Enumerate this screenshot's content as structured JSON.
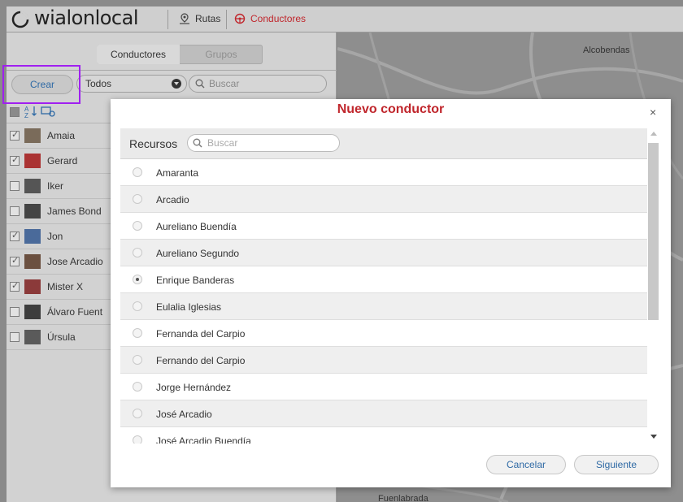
{
  "header": {
    "logo_text": "wialonlocal",
    "nav": [
      {
        "label": "Rutas",
        "icon": "route-pin-icon"
      },
      {
        "label": "Conductores",
        "icon": "steering-wheel-icon"
      }
    ]
  },
  "sidebar": {
    "tabs": [
      "Conductores",
      "Grupos"
    ],
    "create_label": "Crear",
    "filter_value": "Todos",
    "search_placeholder": "Buscar",
    "drivers": [
      {
        "name": "Amaia",
        "checked": true
      },
      {
        "name": "Gerard",
        "checked": true
      },
      {
        "name": "Iker",
        "checked": false
      },
      {
        "name": "James Bond",
        "checked": false
      },
      {
        "name": "Jon",
        "checked": true
      },
      {
        "name": "Jose Arcadio",
        "checked": true
      },
      {
        "name": "Mister X",
        "checked": true
      },
      {
        "name": "Álvaro Fuent",
        "checked": false
      },
      {
        "name": "Úrsula",
        "checked": false
      }
    ]
  },
  "map": {
    "labels": [
      "Alcobendas",
      "Fuenlabrada"
    ]
  },
  "modal": {
    "title": "Nuevo conductor",
    "resources_label": "Recursos",
    "search_placeholder": "Buscar",
    "resources": [
      {
        "name": "Amaranta",
        "selected": false
      },
      {
        "name": "Arcadio",
        "selected": false
      },
      {
        "name": "Aureliano Buendía",
        "selected": false
      },
      {
        "name": "Aureliano Segundo",
        "selected": false
      },
      {
        "name": "Enrique Banderas",
        "selected": true
      },
      {
        "name": "Eulalia Iglesias",
        "selected": false
      },
      {
        "name": "Fernanda del Carpio",
        "selected": false
      },
      {
        "name": "Fernando del Carpio",
        "selected": false
      },
      {
        "name": "Jorge Hernández",
        "selected": false
      },
      {
        "name": "José Arcadio",
        "selected": false
      },
      {
        "name": "José Arcadio Buendía",
        "selected": false
      }
    ],
    "cancel_label": "Cancelar",
    "next_label": "Siguiente",
    "close_glyph": "×"
  },
  "colors": {
    "accent_red": "#c0262c",
    "link_blue": "#2f6aa5",
    "highlight_purple": "#a020f0"
  }
}
